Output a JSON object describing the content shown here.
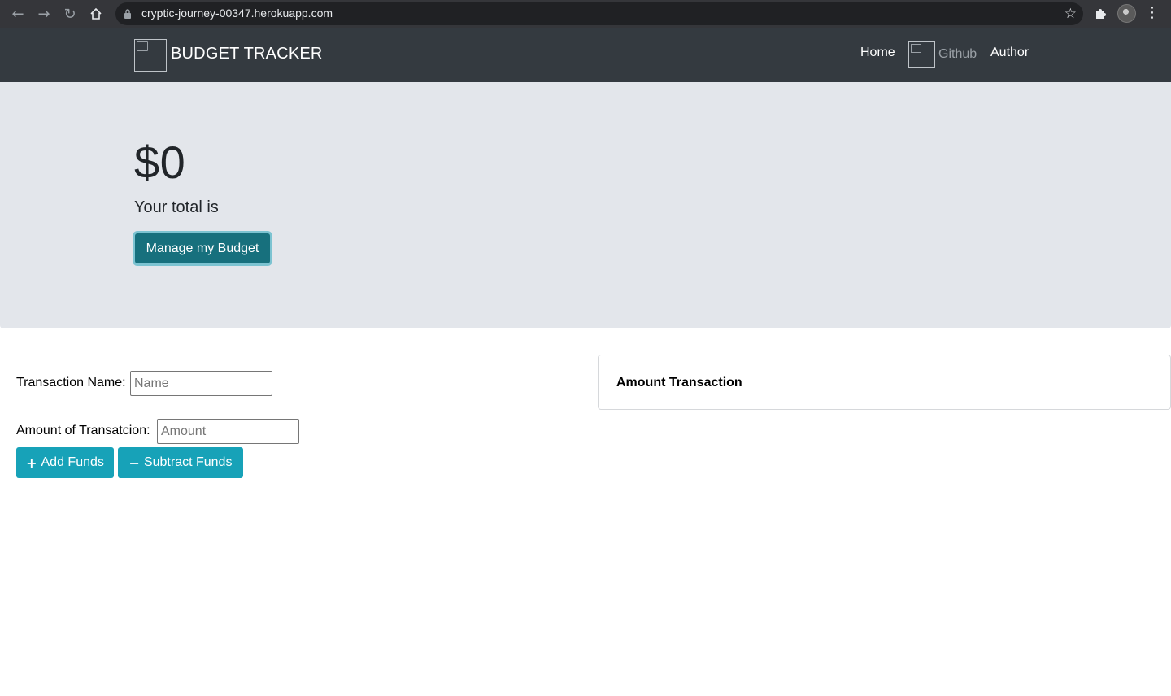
{
  "browser": {
    "url": "cryptic-journey-00347.herokuapp.com",
    "icons": [
      "back-icon",
      "forward-icon",
      "reload-icon",
      "home-icon",
      "lock-icon",
      "star-icon",
      "extensions-icon",
      "profile-avatar",
      "menu-icon"
    ]
  },
  "navbar": {
    "brand": "BUDGET TRACKER",
    "links": {
      "home": "Home",
      "github": "Github",
      "author": "Author"
    }
  },
  "jumbotron": {
    "total": "$0",
    "total_label": "Your total is",
    "manage_button": "Manage my Budget"
  },
  "form": {
    "name_label": "Transaction Name:",
    "name_placeholder": "Name",
    "amount_label": "Amount of Transatcion:",
    "amount_placeholder": "Amount",
    "add_button": "Add Funds",
    "subtract_button": "Subtract Funds"
  },
  "transactions": {
    "header": "Amount Transaction"
  },
  "colors": {
    "navbar": "#343a40",
    "jumbotron": "#e3e6eb",
    "primary_button": "#17707d",
    "info_button": "#17a2b8"
  }
}
